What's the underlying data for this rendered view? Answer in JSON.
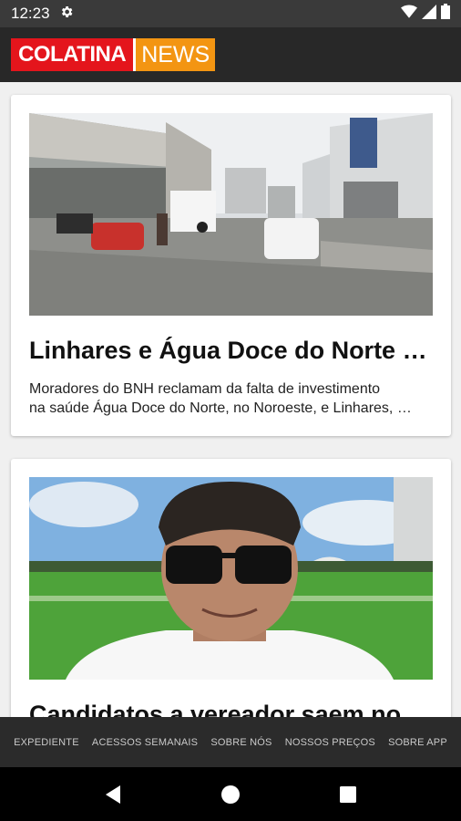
{
  "status_bar": {
    "time": "12:23",
    "icons": [
      "settings-icon",
      "wifi-icon",
      "signal-icon",
      "battery-icon"
    ]
  },
  "app_bar": {
    "logo_part1": "COLATINA",
    "logo_part2": "NEWS",
    "colors": {
      "logo_red": "#e4151c",
      "logo_orange": "#f39512",
      "bar_bg": "#282828"
    }
  },
  "articles": [
    {
      "title": "Linhares e Água Doce do Norte …",
      "excerpt_line1": "Moradores do BNH reclamam da falta de investimento",
      "excerpt_line2": "na saúde Água Doce do Norte, no Noroeste, e Linhares, …"
    },
    {
      "title": "Candidatos a vereador saem no"
    }
  ],
  "footer_menu": [
    "EXPEDIENTE",
    "ACESSOS SEMANAIS",
    "SOBRE NÓS",
    "NOSSOS PREÇOS",
    "SOBRE APP"
  ],
  "nav_bar": [
    "back-icon",
    "home-icon",
    "recents-icon"
  ]
}
